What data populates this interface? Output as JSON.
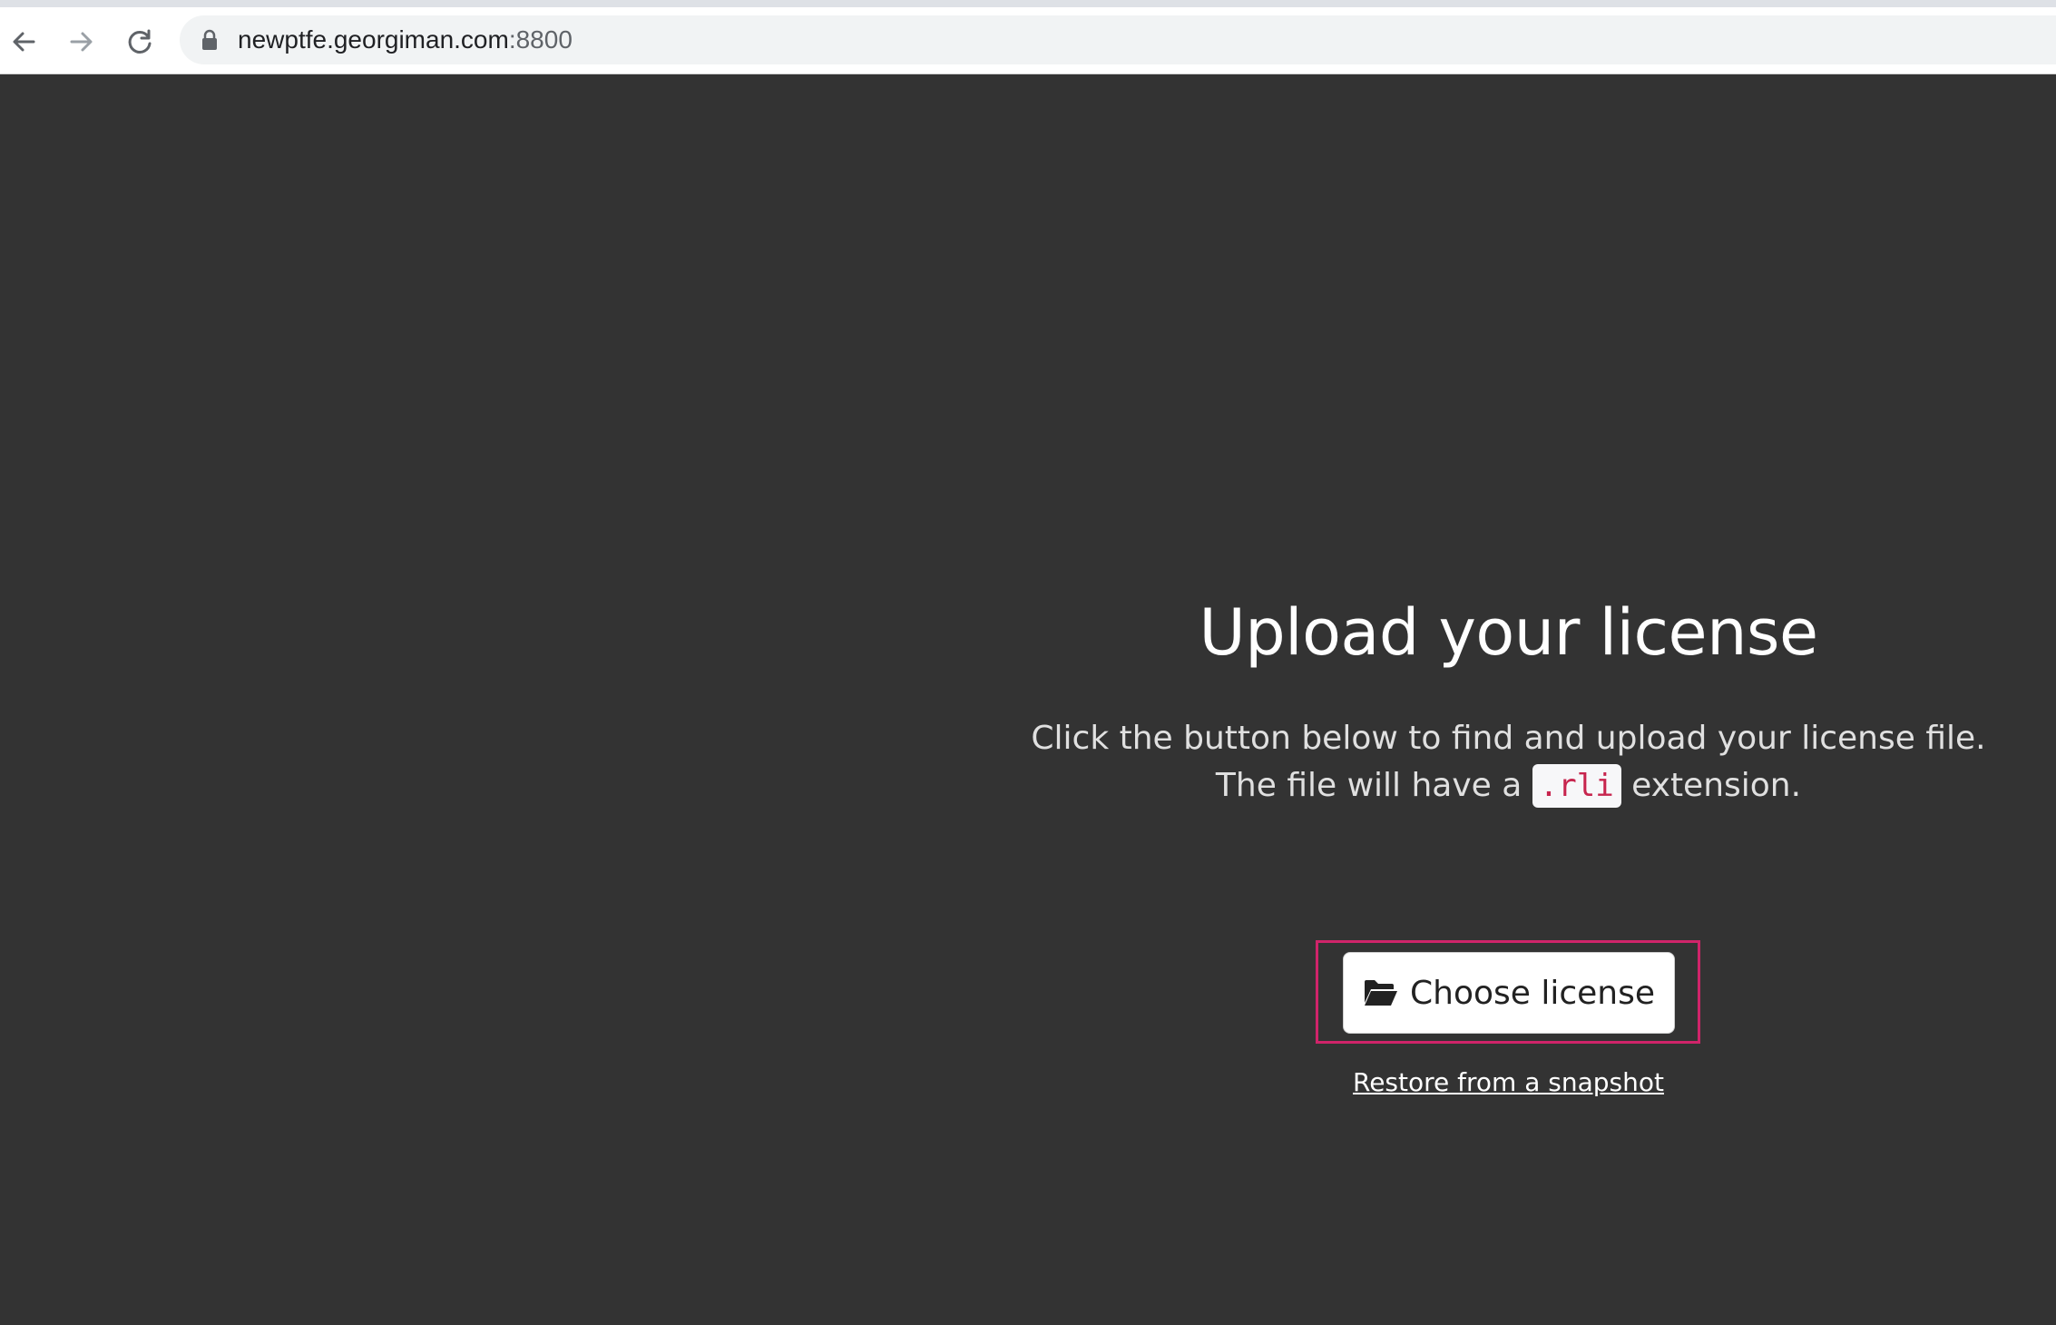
{
  "browser": {
    "url_host": "newptfe.georgiman.com",
    "url_port": ":8800"
  },
  "page": {
    "title": "Upload your license",
    "description_line1": "Click the button below to find and upload your license file.",
    "description_line2_before": "The file will have a",
    "extension_code": ".rli",
    "description_line2_after": "extension.",
    "choose_button_label": "Choose license",
    "restore_link_label": "Restore from a snapshot"
  },
  "icons": {
    "back": "arrow-left-icon",
    "forward": "arrow-right-icon",
    "reload": "reload-icon",
    "lock": "lock-icon",
    "folder": "folder-open-icon"
  },
  "colors": {
    "background": "#333333",
    "highlight_border": "#d0246a",
    "code_text": "#c7254e"
  }
}
